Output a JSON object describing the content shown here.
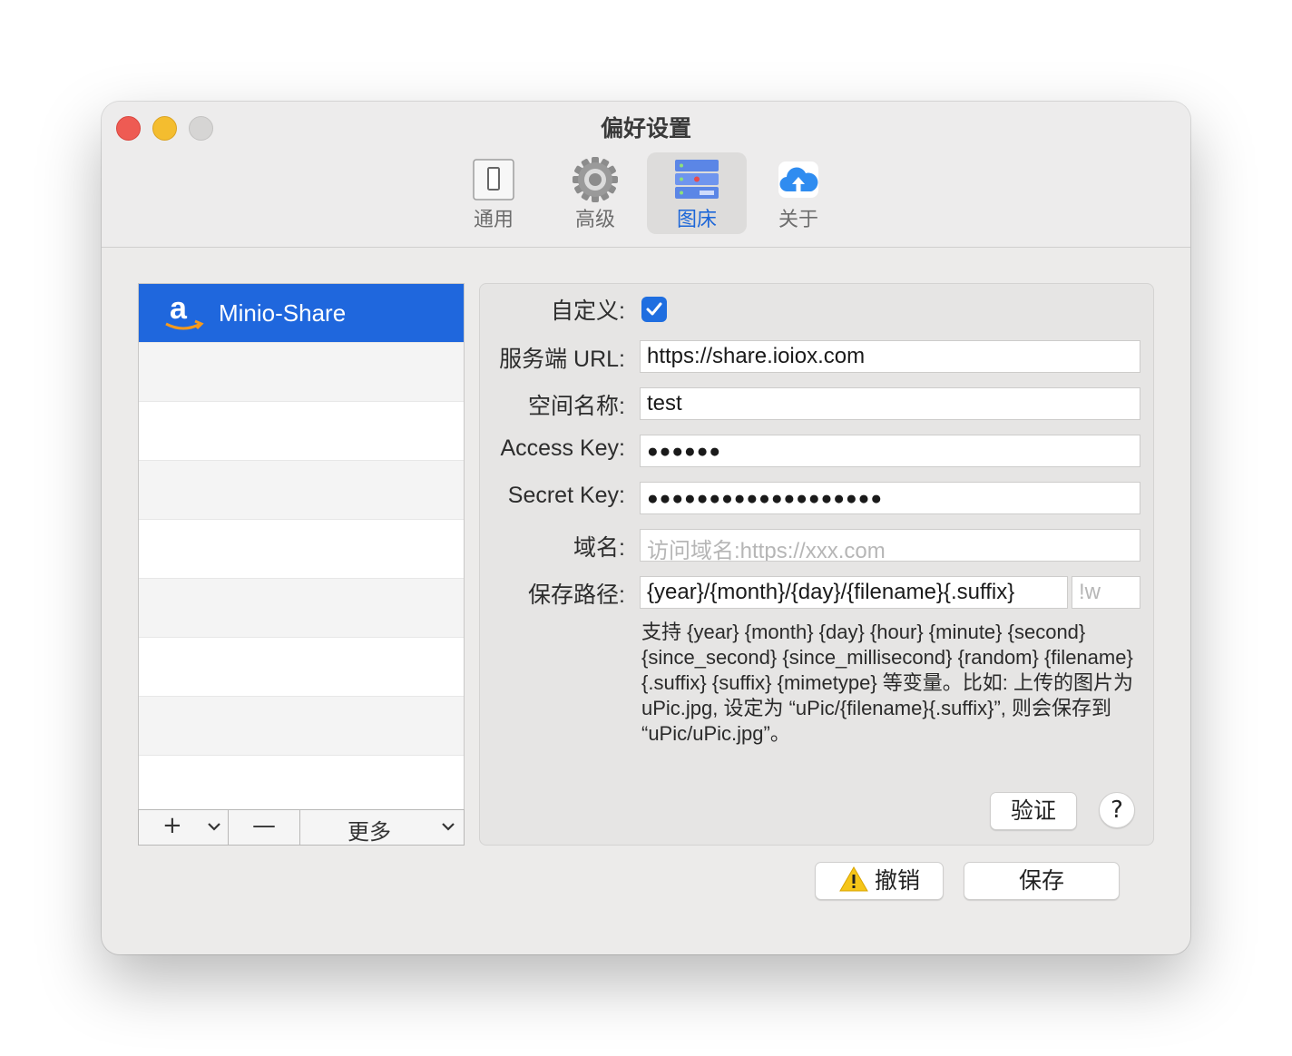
{
  "window": {
    "title": "偏好设置"
  },
  "toolbar": {
    "items": [
      {
        "label": "通用",
        "icon": "switch-icon"
      },
      {
        "label": "高级",
        "icon": "gear-icon"
      },
      {
        "label": "图床",
        "icon": "server-icon",
        "selected": true
      },
      {
        "label": "关于",
        "icon": "cloud-upload-icon"
      }
    ]
  },
  "hosts": {
    "items": [
      {
        "label": "Minio-Share",
        "icon": "amazon-icon",
        "selected": true
      }
    ],
    "add_label": "+",
    "remove_label": "—",
    "more_label": "更多"
  },
  "form": {
    "custom_label": "自定义:",
    "custom_checked": true,
    "server_url_label": "服务端 URL:",
    "server_url_value": "https://share.ioiox.com",
    "bucket_label": "空间名称:",
    "bucket_value": "test",
    "access_key_label": "Access Key:",
    "access_key_value": "●●●●●●",
    "secret_key_label": "Secret Key:",
    "secret_key_value": "●●●●●●●●●●●●●●●●●●●",
    "domain_label": "域名:",
    "domain_placeholder": "访问域名:https://xxx.com",
    "save_path_label": "保存路径:",
    "save_path_value": "{year}/{month}/{day}/{filename}{.suffix}",
    "suffix_placeholder": "!w",
    "help_text": "支持 {year} {month} {day} {hour} {minute} {second} {since_second} {since_millisecond} {random} {filename} {.suffix} {suffix} {mimetype} 等变量。比如: 上传的图片为 uPic.jpg, 设定为 “uPic/{filename}{.suffix}”, 则会保存到 “uPic/uPic.jpg”。",
    "verify_label": "验证",
    "help_button_label": "?"
  },
  "footer": {
    "revert_label": "撤销",
    "save_label": "保存"
  },
  "colors": {
    "accent": "#1f67dd",
    "selected_text": "#1c66d8",
    "warning": "#f5c518"
  }
}
